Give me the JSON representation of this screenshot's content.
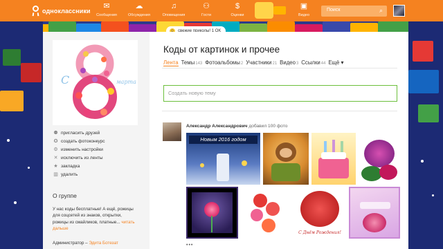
{
  "topbar": {
    "logo_text": "одноклассники",
    "nav": [
      {
        "icon": "mail-icon",
        "glyph": "✉",
        "label": "Сообщения"
      },
      {
        "icon": "discussions-icon",
        "glyph": "☁",
        "label": "Обсуждения"
      },
      {
        "icon": "bell-icon",
        "glyph": "🔔",
        "label": "Оповещения"
      },
      {
        "icon": "guests-icon",
        "glyph": "👣",
        "label": "Гости"
      },
      {
        "icon": "ratings-icon",
        "glyph": "$",
        "label": "Оценки"
      },
      {
        "icon": "video-icon",
        "glyph": "🎥",
        "label": "Видео"
      }
    ],
    "search_placeholder": "Поиск"
  },
  "hint": {
    "text": "свежие приколы! 1 OK"
  },
  "group": {
    "photo_letter_left": "С",
    "photo_letter_right": "марта",
    "actions": [
      {
        "icon": "invite-icon",
        "glyph": "👥",
        "label": "пригласить друзей"
      },
      {
        "icon": "photo-contest-icon",
        "glyph": "🏅",
        "label": "создать фотоконкурс"
      },
      {
        "icon": "settings-icon",
        "glyph": "⚙",
        "label": "изменить настройки"
      },
      {
        "icon": "exclude-icon",
        "glyph": "✖",
        "label": "исключить из ленты"
      },
      {
        "icon": "bookmark-icon",
        "glyph": "★",
        "label": "закладка"
      },
      {
        "icon": "trash-icon",
        "glyph": "🗑",
        "label": "удалить"
      }
    ],
    "about_title": "О группе",
    "about_text": "У нас коды бесплатные! А ещё, рожицы для соцсетей из знаков, открытки, рожицы из смайликов, платные...",
    "about_more": "читать дальше",
    "admin_label": "Администратор –",
    "admin_name": "Эдита Ботезат"
  },
  "main": {
    "title": "Коды от картинок и прочее",
    "tabs": [
      {
        "label": "Лента",
        "count": "",
        "active": true
      },
      {
        "label": "Темы",
        "count": "143",
        "active": false
      },
      {
        "label": "Фотоальбомы",
        "count": "2",
        "active": false
      },
      {
        "label": "Участники",
        "count": "21",
        "active": false
      },
      {
        "label": "Видео",
        "count": "3",
        "active": false
      },
      {
        "label": "Ссылки",
        "count": "44",
        "active": false
      },
      {
        "label": "Ещё ▾",
        "count": "",
        "active": false
      }
    ],
    "compose_placeholder": "Создать новую тему",
    "post": {
      "author": "Александр Александрович",
      "action": "добавил 100 фото",
      "images": [
        {
          "name": "new-year-2016-image",
          "caption": "Новым 2016 годом"
        },
        {
          "name": "monkey-image",
          "caption": ""
        },
        {
          "name": "birthday-cake-image",
          "caption": ""
        },
        {
          "name": "purple-roses-image",
          "caption": ""
        },
        {
          "name": "pink-rose-image",
          "caption": ""
        },
        {
          "name": "red-flowers-image",
          "caption": ""
        },
        {
          "name": "red-roses-bouquet-image",
          "caption": "С Днём Рождения!"
        },
        {
          "name": "greeting-card-image",
          "caption": ""
        }
      ],
      "more": "•••"
    }
  }
}
